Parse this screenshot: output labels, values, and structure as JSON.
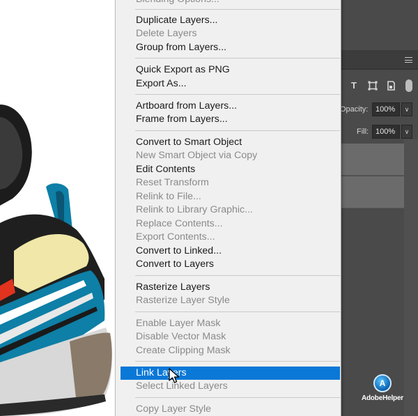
{
  "context_menu": {
    "items": [
      {
        "label": "Blending Options...",
        "enabled": false
      },
      {
        "label": "Duplicate Layers...",
        "enabled": true
      },
      {
        "label": "Delete Layers",
        "enabled": false
      },
      {
        "label": "Group from Layers...",
        "enabled": true
      },
      {
        "label": "Quick Export as PNG",
        "enabled": true
      },
      {
        "label": "Export As...",
        "enabled": true
      },
      {
        "label": "Artboard from Layers...",
        "enabled": true
      },
      {
        "label": "Frame from Layers...",
        "enabled": true
      },
      {
        "label": "Convert to Smart Object",
        "enabled": true
      },
      {
        "label": "New Smart Object via Copy",
        "enabled": false
      },
      {
        "label": "Edit Contents",
        "enabled": true
      },
      {
        "label": "Reset Transform",
        "enabled": false
      },
      {
        "label": "Relink to File...",
        "enabled": false
      },
      {
        "label": "Relink to Library Graphic...",
        "enabled": false
      },
      {
        "label": "Replace Contents...",
        "enabled": false
      },
      {
        "label": "Export Contents...",
        "enabled": false
      },
      {
        "label": "Convert to Linked...",
        "enabled": true
      },
      {
        "label": "Convert to Layers",
        "enabled": true
      },
      {
        "label": "Rasterize Layers",
        "enabled": true
      },
      {
        "label": "Rasterize Layer Style",
        "enabled": false
      },
      {
        "label": "Enable Layer Mask",
        "enabled": false
      },
      {
        "label": "Disable Vector Mask",
        "enabled": false
      },
      {
        "label": "Create Clipping Mask",
        "enabled": false
      },
      {
        "label": "Link Layers",
        "enabled": true,
        "highlighted": true
      },
      {
        "label": "Select Linked Layers",
        "enabled": false
      },
      {
        "label": "Copy Layer Style",
        "enabled": false
      }
    ],
    "highlight_color": "#0a78d7"
  },
  "layers_panel": {
    "opacity_label": "Opacity:",
    "opacity_value": "100%",
    "fill_label": "Fill:",
    "fill_value": "100%",
    "filter_icons": [
      "type-filter-icon",
      "shape-filter-icon",
      "smart-object-filter-icon",
      "filter-toggle-icon"
    ]
  },
  "watermark": {
    "text": "AdobeHelper",
    "logo_glyph": "A"
  },
  "colors": {
    "panel_bg": "#4a4a4a",
    "menu_bg": "#f0f0f0",
    "shoe_blue": "#0e7fa6",
    "shoe_yellow": "#f0e7a8"
  }
}
